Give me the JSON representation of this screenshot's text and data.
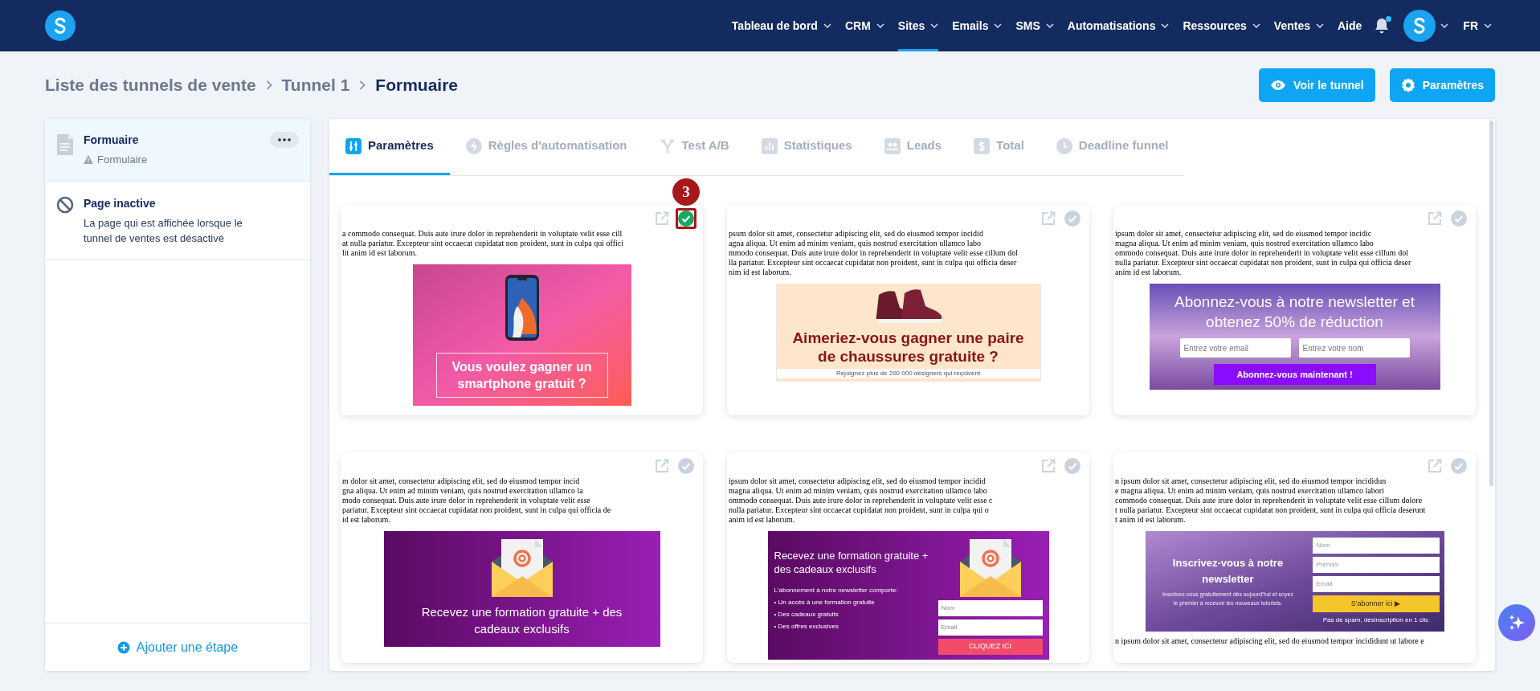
{
  "nav": {
    "items": [
      {
        "label": "Tableau de bord",
        "has_menu": true,
        "selected": false
      },
      {
        "label": "CRM",
        "has_menu": true,
        "selected": false
      },
      {
        "label": "Sites",
        "has_menu": true,
        "selected": true
      },
      {
        "label": "Emails",
        "has_menu": true,
        "selected": false
      },
      {
        "label": "SMS",
        "has_menu": true,
        "selected": false
      },
      {
        "label": "Automatisations",
        "has_menu": true,
        "selected": false
      },
      {
        "label": "Ressources",
        "has_menu": true,
        "selected": false
      },
      {
        "label": "Ventes",
        "has_menu": true,
        "selected": false
      },
      {
        "label": "Aide",
        "has_menu": false,
        "selected": false
      }
    ],
    "notifications_unread": true,
    "language": "FR"
  },
  "breadcrumb": [
    {
      "label": "Liste des tunnels de vente",
      "current": false
    },
    {
      "label": "Tunnel 1",
      "current": false
    },
    {
      "label": "Formuaire",
      "current": true
    }
  ],
  "actions": [
    {
      "kind": "view",
      "label": "Voir le tunnel"
    },
    {
      "kind": "settings",
      "label": "Paramètres"
    }
  ],
  "steps": [
    {
      "kind": "form",
      "title": "Formuaire",
      "subtitle": "Formulaire",
      "selected": true
    },
    {
      "kind": "inactive",
      "title": "Page inactive",
      "description": "La page qui est affichée lorsque le tunnel de ventes est désactivé",
      "selected": false
    }
  ],
  "add_step": "Ajouter une étape",
  "tabs": [
    {
      "kind": "sliders",
      "label": "Paramètres",
      "selected": true,
      "disabled": false
    },
    {
      "kind": "bolt",
      "label": "Règles d'automatisation",
      "selected": false,
      "disabled": true
    },
    {
      "kind": "split",
      "label": "Test A/B",
      "selected": false,
      "disabled": true
    },
    {
      "kind": "chart",
      "label": "Statistiques",
      "selected": false,
      "disabled": true
    },
    {
      "kind": "people",
      "label": "Leads",
      "selected": false,
      "disabled": true
    },
    {
      "kind": "dollar",
      "label": "Total",
      "selected": false,
      "disabled": true
    },
    {
      "kind": "clock",
      "label": "Deadline funnel",
      "selected": false,
      "disabled": true
    }
  ],
  "templates": [
    {
      "selected": true,
      "step_badge": "3",
      "text_before": [
        "a commodo consequat. Duis aute irure dolor in reprehenderit in voluptate velit esse cill",
        "at nulla pariatur. Excepteur sint occaecat cupidatat non proident, sunt in culpa qui offici",
        "lit anim id est laborum."
      ],
      "banner": {
        "kind": "phone",
        "title": "Vous voulez gagner un smartphone gratuit ?"
      }
    },
    {
      "selected": false,
      "text_before": [
        "psum dolor sit amet, consectetur adipiscing elit, sed do eiusmod tempor incidid",
        "agna aliqua. Ut enim ad minim veniam, quis nostrud exercitation ullamco labo",
        "mmodo consequat. Duis aute irure dolor in reprehenderit in voluptate velit esse cillum dol",
        "lla pariatur. Excepteur sint occaecat cupidatat non proident, sunt in culpa qui officia deser",
        "nim id est laborum."
      ],
      "banner": {
        "kind": "shoe",
        "title": "Aimeriez-vous gagner une paire de chaussures gratuite ?",
        "note": "Rejoignez plus de 200 000 designers qui reçoivent"
      }
    },
    {
      "selected": false,
      "text_before": [
        "ipsum dolor sit amet, consectetur adipiscing elit, sed do eiusmod tempor incidic",
        "magna aliqua. Ut enim ad minim veniam, quis nostrud exercitation ullamco labo",
        "ommodo consequat. Duis aute irure dolor in reprehenderit in voluptate velit esse cillum dol",
        "nulla pariatur. Excepteur sint occaecat cupidatat non proident, sunt in culpa qui officia deser",
        "anim id est laborum."
      ],
      "banner": {
        "kind": "beach",
        "title": "Abonnez-vous à notre newsletter et obtenez 50% de réduction",
        "fields": [
          {
            "placeholder": "Entrez votre email"
          },
          {
            "placeholder": "Entrez votre nom"
          }
        ],
        "button": "Abonnez-vous maintenant !"
      }
    },
    {
      "selected": false,
      "text_before": [
        "m dolor sit amet, consectetur adipiscing elit, sed do eiusmod tempor incid",
        "gna aliqua. Ut enim ad minim veniam, quis nostrud exercitation ullamco la",
        "modo consequat. Duis aute irure dolor in reprehenderit in voluptate velit esse",
        "pariatur. Excepteur sint occaecat cupidatat non proident, sunt in culpa qui officia de",
        "id est laborum."
      ],
      "banner": {
        "kind": "envelope",
        "title": "Recevez une formation gratuite + des cadeaux exclusifs"
      }
    },
    {
      "selected": false,
      "text_before": [
        "ipsum dolor sit amet, consectetur adipiscing elit, sed do eiusmod tempor incidid",
        "magna aliqua. Ut enim ad minim veniam, quis nostrud exercitation ullamco labo",
        "ommodo consequat. Duis aute irure dolor in reprehenderit in voluptate velit esse c",
        "nulla pariatur. Excepteur sint occaecat cupidatat non proident, sunt in culpa qui o",
        "anim id est laborum."
      ],
      "banner": {
        "kind": "envelope_form",
        "title": "Recevez une formation gratuite + des cadeaux exclusifs",
        "intro": "L'abonnement à notre newsletter comporte:",
        "bullets": [
          "• Un accès à une formation gratuite",
          "• Des cadeaux gratuits",
          "• Des offres exclusives"
        ],
        "fields": [
          {
            "placeholder": "Nom"
          },
          {
            "placeholder": "Email"
          }
        ],
        "button": "CLIQUEZ ICI"
      }
    },
    {
      "selected": false,
      "text_before": [
        "n ipsum dolor sit amet, consectetur adipiscing elit, sed do eiusmod tempor incididun",
        "e magna aliqua. Ut enim ad minim veniam, quis nostrud exercitation ullamco labori",
        "commodo consequat. Duis aute irure dolor in reprehenderit in voluptate velit esse cillum dolore",
        "t nulla pariatur. Excepteur sint occaecat cupidatat non proident, sunt in culpa qui officia deserunt",
        "t anim id est laborum."
      ],
      "banner": {
        "kind": "laptop",
        "title": "Inscrivez-vous à notre newsletter",
        "subtitle": "Inscrivez-vous gratuitement dès aujourd'hui et soyez le premier à recevoir les nouveaux tutoriels.",
        "fields": [
          {
            "placeholder": "Nom"
          },
          {
            "placeholder": "Prénom"
          },
          {
            "placeholder": "Email"
          }
        ],
        "button": "S'abonner ici ▶",
        "note": "Pas de spam, désinscription en 1 clic"
      },
      "text_after": [
        "n ipsum dolor sit amet, consectetur adipiscing elit, sed do eiusmod tempor incididunt ut labore e"
      ]
    }
  ]
}
